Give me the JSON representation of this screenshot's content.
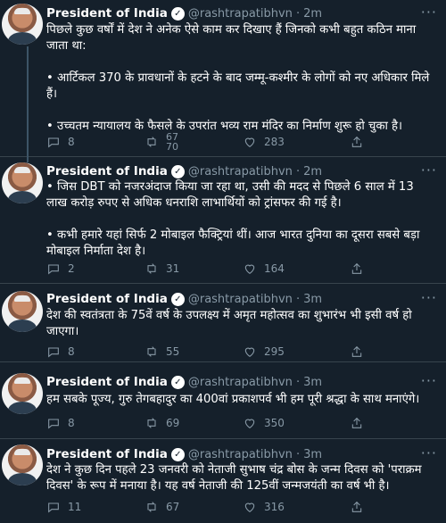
{
  "tweets": [
    {
      "name": "President of India",
      "handle": "@rashtrapatibhvn",
      "time": "2m",
      "lines": [
        "पिछले कुछ वर्षों में देश ने अनेक ऐसे काम कर दिखाए हैं जिनको कभी बहुत कठिन माना जाता था:",
        "",
        "• आर्टिकल 370 के प्रावधानों के हटने के बाद जम्मू-कश्मीर के लोगों को नए अधिकार मिले हैं।",
        "",
        "• उच्चतम न्यायालय के फैसले के उपरांत भव्य राम मंदिर का निर्माण शुरू हो चुका है।"
      ],
      "replies": "8",
      "retweets_top": "67",
      "retweets_bottom": "70",
      "likes": "283"
    },
    {
      "name": "President of India",
      "handle": "@rashtrapatibhvn",
      "time": "2m",
      "lines": [
        "• जिस DBT को नजरअंदाज किया जा रहा था, उसी की मदद से पिछले 6 साल में 13 लाख करोड़ रुपए से अधिक धनराशि लाभार्थियों को ट्रांसफर की गई है।",
        "",
        "• कभी हमारे यहां सिर्फ 2 मोबाइल फैक्ट्रियां थीं। आज भारत दुनिया का दूसरा सबसे बड़ा मोबाइल निर्माता देश है।"
      ],
      "replies": "2",
      "retweets": "31",
      "likes": "164"
    },
    {
      "name": "President of India",
      "handle": "@rashtrapatibhvn",
      "time": "3m",
      "lines": [
        "देश की स्वतंत्रता के 75वें वर्ष के उपलक्ष्य में अमृत महोत्सव का शुभारंभ भी इसी वर्ष हो जाएगा।"
      ],
      "replies": "8",
      "retweets": "55",
      "likes": "295"
    },
    {
      "name": "President of India",
      "handle": "@rashtrapatibhvn",
      "time": "3m",
      "lines": [
        "हम सबके पूज्य, गुरु तेगबहादुर का 400वां प्रकाशपर्व भी हम पूरी श्रद्धा के साथ मनाएंगे।"
      ],
      "replies": "8",
      "retweets": "69",
      "likes": "350"
    },
    {
      "name": "President of India",
      "handle": "@rashtrapatibhvn",
      "time": "3m",
      "lines": [
        "देश ने कुछ दिन पहले 23 जनवरी को नेताजी सुभाष चंद्र बोस के जन्म दिवस को 'पराक्रम दिवस' के रूप में मनाया है। यह वर्ष नेताजी की 125वीं जन्मजयंती का वर्ष भी है।"
      ],
      "replies": "11",
      "retweets": "67",
      "likes": "316"
    }
  ],
  "icons": {
    "verified": "verified-badge-icon",
    "reply": "reply-icon",
    "retweet": "retweet-icon",
    "like": "heart-icon",
    "share": "share-icon"
  },
  "colors": {
    "background": "#15202b",
    "muted": "#8899a6",
    "divider": "#38444d"
  }
}
